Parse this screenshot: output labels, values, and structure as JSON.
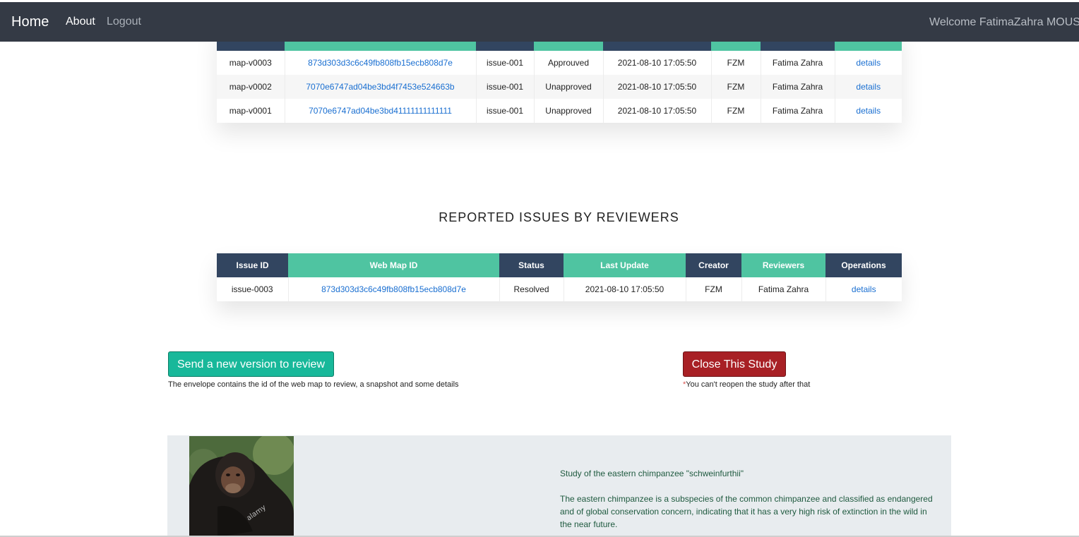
{
  "nav": {
    "home": "Home",
    "about": "About",
    "logout": "Logout",
    "welcome": "Welcome FatimaZahra MOUS"
  },
  "versions_table": {
    "rows": [
      {
        "version": "map-v0003",
        "web_map_id": "873d303d3c6c49fb808fb15ecb808d7e",
        "issue": "issue-001",
        "status": "Approuved",
        "date": "2021-08-10 17:05:50",
        "creator": "FZM",
        "reviewer": "Fatima Zahra",
        "operation": "details"
      },
      {
        "version": "map-v0002",
        "web_map_id": "7070e6747ad04be3bd4f7453e524663b",
        "issue": "issue-001",
        "status": "Unapproved",
        "date": "2021-08-10 17:05:50",
        "creator": "FZM",
        "reviewer": "Fatima Zahra",
        "operation": "details"
      },
      {
        "version": "map-v0001",
        "web_map_id": "7070e6747ad04be3bd41111111111111",
        "issue": "issue-001",
        "status": "Unapproved",
        "date": "2021-08-10 17:05:50",
        "creator": "FZM",
        "reviewer": "Fatima Zahra",
        "operation": "details"
      }
    ]
  },
  "issues_section": {
    "title": "REPORTED ISSUES BY REVIEWERS",
    "headers": [
      "Issue ID",
      "Web Map ID",
      "Status",
      "Last Update",
      "Creator",
      "Reviewers",
      "Operations"
    ],
    "rows": [
      {
        "issue_id": "issue-0003",
        "web_map_id": "873d303d3c6c49fb808fb15ecb808d7e",
        "status": "Resolved",
        "last_update": "2021-08-10 17:05:50",
        "creator": "FZM",
        "reviewers": "Fatima Zahra",
        "operation": "details"
      }
    ]
  },
  "actions": {
    "send_label": "Send a new version to review",
    "send_note": "The envelope contains the id of the web map to review, a snapshot and some details",
    "close_label": "Close This Study",
    "close_note_star": "*",
    "close_note": "You can't reopen the study after that"
  },
  "study": {
    "image_watermark": "alamy",
    "title": "Study of the eastern chimpanzee \"schweinfurthii\"",
    "description": "The eastern chimpanzee is a subspecies of the common chimpanzee and classified as endangered and of global conservation concern, indicating that it has a very high risk of extinction in the wild in the near future."
  },
  "colors": {
    "navbar": "#343a45",
    "header_dark": "#324560",
    "header_green": "#4fc4a1",
    "send_button": "#18b89a",
    "close_button": "#a82025",
    "link": "#1a6fd1"
  }
}
